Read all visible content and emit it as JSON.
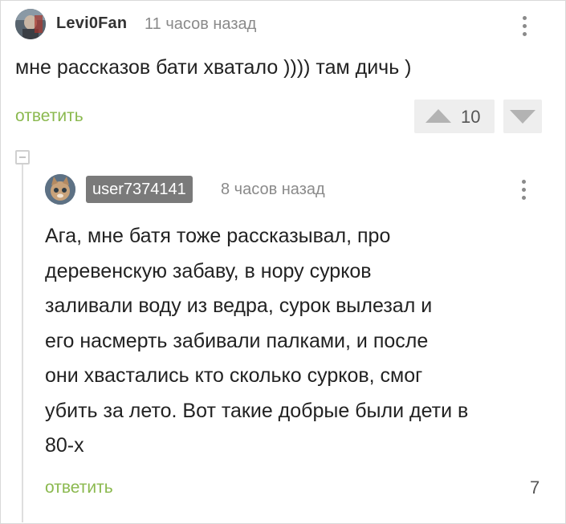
{
  "comment": {
    "author": "Levi0Fan",
    "time": "11 часов назад",
    "text": "мне рассказов бати хватало )))) там дичь )",
    "reply_label": "ответить",
    "rating": "10"
  },
  "reply": {
    "author": "user7374141",
    "time": "8 часов назад",
    "text_lines": [
      "Ага, мне батя тоже рассказывал, про",
      "деревенскую забаву, в нору сурков",
      "заливали воду из ведра, сурок вылезал и",
      "его насмерть забивали палками, и после",
      "они хвастались кто сколько сурков, смог",
      "убить за лето. Вот такие добрые были дети в",
      "80-х"
    ],
    "reply_label": "ответить",
    "rating": "7"
  },
  "colors": {
    "accent_green": "#8bb94f",
    "username_badge": "#7a7a7a"
  },
  "icons": [
    "more-vertical-icon",
    "upvote-icon",
    "downvote-icon",
    "collapse-icon"
  ]
}
